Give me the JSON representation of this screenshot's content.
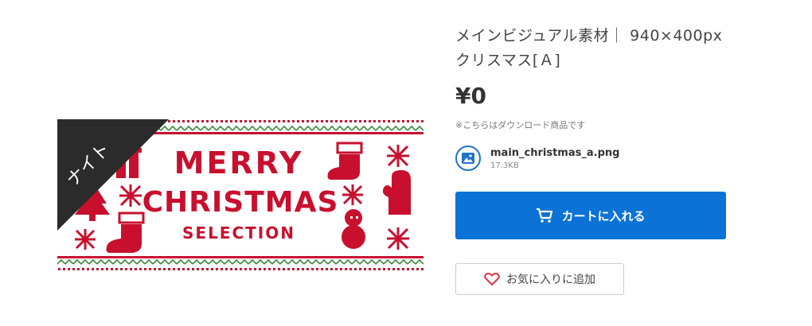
{
  "product": {
    "title": "メインビジュアル素材｜ 940×400px クリスマス[Ａ]",
    "price": "¥0",
    "download_note": "※こちらはダウンロード商品です",
    "file": {
      "name": "main_christmas_a.png",
      "size": "17.3KB",
      "icon": "image-file-icon"
    },
    "cart_button": {
      "label": "カートに入れる",
      "icon": "cart-icon",
      "color": "#0b72d6"
    },
    "favorite_button": {
      "label": "お気に入りに追加",
      "icon": "heart-icon",
      "icon_color": "#d9344a"
    }
  },
  "banner": {
    "corner_label": "ナイト",
    "line1": "MERRY",
    "line2": "CHRISTMAS",
    "line3": "SELECTION",
    "accent_color": "#c8102e",
    "secondary_color": "#3a8a3a"
  }
}
